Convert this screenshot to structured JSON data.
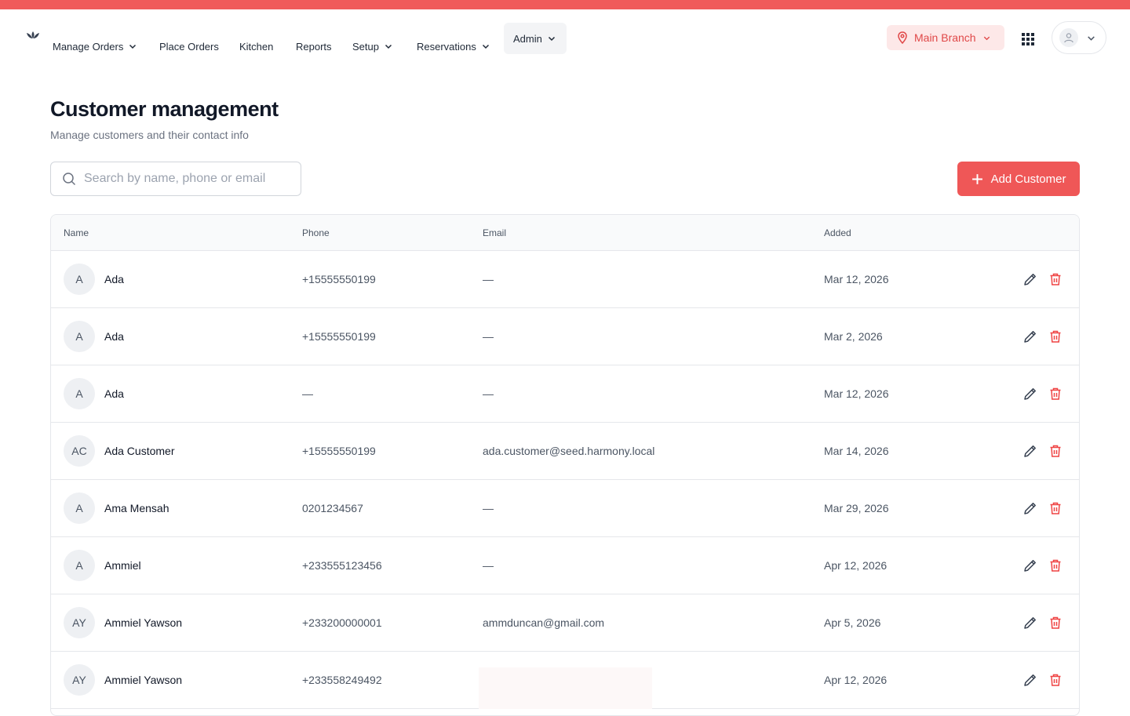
{
  "colors": {
    "accent": "#ef5757",
    "strip": "#f05a5a",
    "accent_soft": "#fde8e8"
  },
  "nav": {
    "logo_icon": "lotus-icon",
    "items": [
      {
        "label": "Manage Orders",
        "has_dropdown": true
      },
      {
        "label": "Place Orders",
        "has_dropdown": false
      },
      {
        "label": "Kitchen",
        "has_dropdown": false
      },
      {
        "label": "Reports",
        "has_dropdown": false
      },
      {
        "label": "Setup",
        "has_dropdown": true
      },
      {
        "label": "Reservations",
        "has_dropdown": true
      },
      {
        "label": "Admin",
        "has_dropdown": true,
        "active": true
      }
    ],
    "branch": "Main Branch",
    "apps_icon": "grid-icon",
    "user_icon": "user-icon"
  },
  "page": {
    "title": "Customer management",
    "subtitle": "Manage customers and their contact info"
  },
  "search": {
    "placeholder": "Search by name, phone or email",
    "value": ""
  },
  "add_button": {
    "label": "Add Customer",
    "icon": "plus-icon"
  },
  "table": {
    "headers": [
      "Name",
      "Phone",
      "Email",
      "Added"
    ],
    "rows": [
      {
        "initials": "A",
        "name": "Ada",
        "phone": "+15555550199",
        "email": "—",
        "added": "Mar 12, 2026"
      },
      {
        "initials": "A",
        "name": "Ada",
        "phone": "+15555550199",
        "email": "—",
        "added": "Mar 2, 2026"
      },
      {
        "initials": "A",
        "name": "Ada",
        "phone": "—",
        "email": "—",
        "added": "Mar 12, 2026"
      },
      {
        "initials": "AC",
        "name": "Ada Customer",
        "phone": "+15555550199",
        "email": "ada.customer@seed.harmony.local",
        "added": "Mar 14, 2026"
      },
      {
        "initials": "A",
        "name": "Ama Mensah",
        "phone": "0201234567",
        "email": "—",
        "added": "Mar 29, 2026"
      },
      {
        "initials": "A",
        "name": "Ammiel",
        "phone": "+233555123456",
        "email": "—",
        "added": "Apr 12, 2026"
      },
      {
        "initials": "AY",
        "name": "Ammiel Yawson",
        "phone": "+233200000001",
        "email": "ammduncan@gmail.com",
        "added": "Apr 5, 2026"
      },
      {
        "initials": "AY",
        "name": "Ammiel Yawson",
        "phone": "+233558249492",
        "email": "",
        "added": "Apr 12, 2026"
      }
    ],
    "row_actions": [
      "pencil-icon",
      "trash-icon"
    ]
  }
}
